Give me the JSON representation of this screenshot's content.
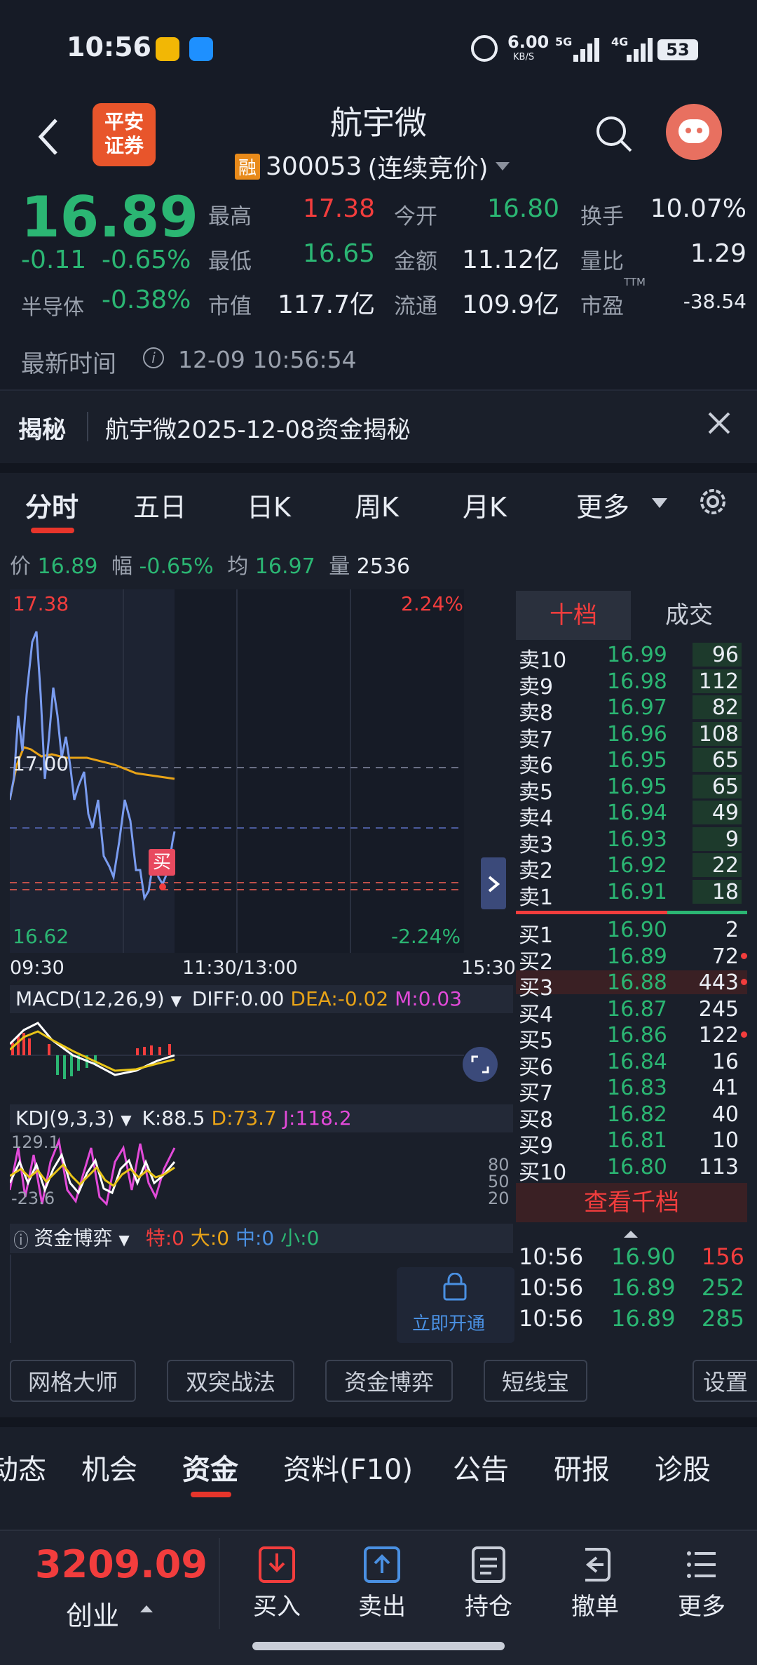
{
  "status": {
    "time": "10:56",
    "speed": "6.00",
    "speed_unit": "KB/S",
    "net1": "5G",
    "net2": "4G",
    "battery": "53"
  },
  "header": {
    "back": "<",
    "broker_line1": "平安",
    "broker_line2": "证券",
    "title": "航宇微",
    "rong": "融",
    "code": "300053",
    "mode": "(连续竞价)"
  },
  "quote": {
    "price": "16.89",
    "change": "-0.11",
    "change_pct": "-0.65%",
    "sector": "半导体",
    "sector_pct": "-0.38%",
    "high_label": "最高",
    "high": "17.38",
    "open_label": "今开",
    "open": "16.80",
    "turnover_label": "换手",
    "turnover": "10.07%",
    "low_label": "最低",
    "low": "16.65",
    "amount_label": "金额",
    "amount": "11.12亿",
    "vol_ratio_label": "量比",
    "vol_ratio": "1.29",
    "mktcap_label": "市值",
    "mktcap": "117.7亿",
    "float_label": "流通",
    "float": "109.9亿",
    "pe_label": "市盈",
    "pe_sup": "TTM",
    "pe": "-38.54",
    "time_label": "最新时间",
    "time": "12-09 10:56:54"
  },
  "reveal": {
    "label": "揭秘",
    "text": "航宇微2025-12-08资金揭秘"
  },
  "tabs": [
    "分时",
    "五日",
    "日K",
    "周K",
    "月K",
    "更多"
  ],
  "chart_info": {
    "price_label": "价",
    "price": "16.89",
    "amp_label": "幅",
    "amp": "-0.65%",
    "avg_label": "均",
    "avg": "16.97",
    "vol_label": "量",
    "vol": "2536"
  },
  "chart_labels": {
    "top_price": "17.38",
    "top_pct": "2.24%",
    "mid_price": "17.00",
    "bot_price": "16.62",
    "bot_pct": "-2.24%",
    "t0": "09:30",
    "t1": "11:30/13:00",
    "t2": "15:30",
    "buy_marker": "买"
  },
  "macd": {
    "name": "MACD(12,26,9)",
    "diff": "DIFF:0.00",
    "dea": "DEA:-0.02",
    "m": "M:0.03"
  },
  "kdj": {
    "name": "KDJ(9,3,3)",
    "k": "K:88.5",
    "d": "D:73.7",
    "j": "J:118.2",
    "top": "129.1",
    "bot": "-23.6",
    "l80": "80",
    "l50": "50",
    "l20": "20"
  },
  "fund": {
    "name": "资金博弈",
    "te": "特:0",
    "da": "大:0",
    "zhong": "中:0",
    "xiao": "小:0",
    "unlock": "立即开通"
  },
  "orderbook": {
    "tab_active": "十档",
    "tab_other": "成交",
    "more": "查看千档",
    "asks": [
      {
        "l": "卖10",
        "p": "16.99",
        "v": "96"
      },
      {
        "l": "卖9",
        "p": "16.98",
        "v": "112"
      },
      {
        "l": "卖8",
        "p": "16.97",
        "v": "82"
      },
      {
        "l": "卖7",
        "p": "16.96",
        "v": "108"
      },
      {
        "l": "卖6",
        "p": "16.95",
        "v": "65"
      },
      {
        "l": "卖5",
        "p": "16.95",
        "v": "65"
      },
      {
        "l": "卖4",
        "p": "16.94",
        "v": "49"
      },
      {
        "l": "卖3",
        "p": "16.93",
        "v": "9"
      },
      {
        "l": "卖2",
        "p": "16.92",
        "v": "22"
      },
      {
        "l": "卖1",
        "p": "16.91",
        "v": "18"
      }
    ],
    "bids": [
      {
        "l": "买1",
        "p": "16.90",
        "v": "2"
      },
      {
        "l": "买2",
        "p": "16.89",
        "v": "72"
      },
      {
        "l": "买3",
        "p": "16.88",
        "v": "443"
      },
      {
        "l": "买4",
        "p": "16.87",
        "v": "245"
      },
      {
        "l": "买5",
        "p": "16.86",
        "v": "122"
      },
      {
        "l": "买6",
        "p": "16.84",
        "v": "16"
      },
      {
        "l": "买7",
        "p": "16.83",
        "v": "41"
      },
      {
        "l": "买8",
        "p": "16.82",
        "v": "40"
      },
      {
        "l": "买9",
        "p": "16.81",
        "v": "10"
      },
      {
        "l": "买10",
        "p": "16.80",
        "v": "113"
      }
    ],
    "trades": [
      {
        "t": "10:56",
        "p": "16.90",
        "v": "156"
      },
      {
        "t": "10:56",
        "p": "16.89",
        "v": "252"
      },
      {
        "t": "10:56",
        "p": "16.89",
        "v": "285"
      }
    ]
  },
  "tools": [
    "网格大师",
    "双突战法",
    "资金博弈",
    "短线宝",
    "设置"
  ],
  "info_tabs": [
    "动态",
    "机会",
    "资金",
    "资料(F10)",
    "公告",
    "研报",
    "诊股"
  ],
  "bottom": {
    "index_value": "3209.09",
    "index_name": "创业",
    "actions": [
      "买入",
      "卖出",
      "持仓",
      "撤单",
      "更多"
    ]
  },
  "colors": {
    "up": "#f23d3d",
    "down": "#2bb673",
    "price_line": "#7a9cf0",
    "avg_line": "#e8a317",
    "accent": "#e8352b"
  }
}
